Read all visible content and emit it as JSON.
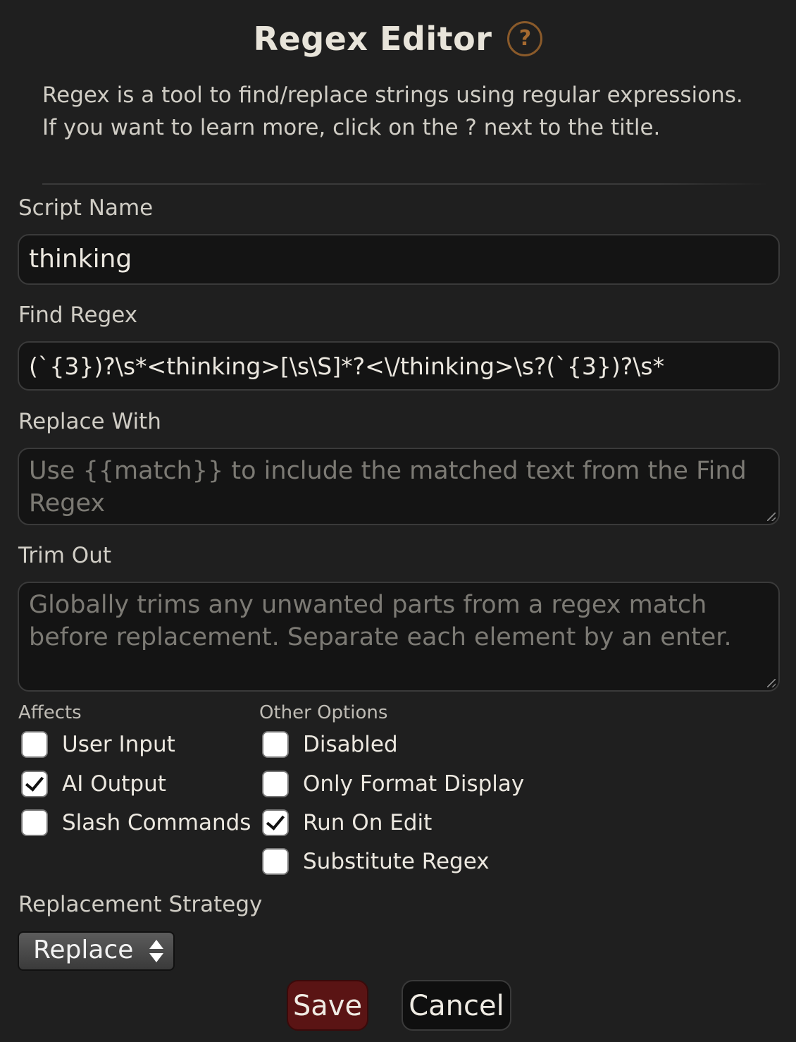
{
  "header": {
    "title": "Regex Editor",
    "help_icon": "?",
    "description": "Regex is a tool to find/replace strings using regular expressions. If you want to learn more, click on the ? next to the title."
  },
  "script_name": {
    "label": "Script Name",
    "value": "thinking"
  },
  "find_regex": {
    "label": "Find Regex",
    "value": "(`{3})?\\s*<thinking>[\\s\\S]*?<\\/thinking>\\s?(`{3})?\\s*"
  },
  "replace_with": {
    "label": "Replace With",
    "placeholder": "Use {{match}} to include the matched text from the Find Regex"
  },
  "trim_out": {
    "label": "Trim Out",
    "placeholder": "Globally trims any unwanted parts from a regex match before replacement. Separate each element by an enter."
  },
  "affects": {
    "heading": "Affects",
    "items": [
      {
        "label": "User Input",
        "checked": false
      },
      {
        "label": "AI Output",
        "checked": true
      },
      {
        "label": "Slash Commands",
        "checked": false
      }
    ]
  },
  "other_options": {
    "heading": "Other Options",
    "items": [
      {
        "label": "Disabled",
        "checked": false
      },
      {
        "label": "Only Format Display",
        "checked": false
      },
      {
        "label": "Run On Edit",
        "checked": true
      },
      {
        "label": "Substitute Regex",
        "checked": false
      }
    ]
  },
  "replacement_strategy": {
    "label": "Replacement Strategy",
    "selected": "Replace"
  },
  "actions": {
    "save_label": "Save",
    "cancel_label": "Cancel"
  },
  "colors": {
    "background": "#1f1f1f",
    "save_button": "#5a1414",
    "help_icon": "#a66a30"
  }
}
